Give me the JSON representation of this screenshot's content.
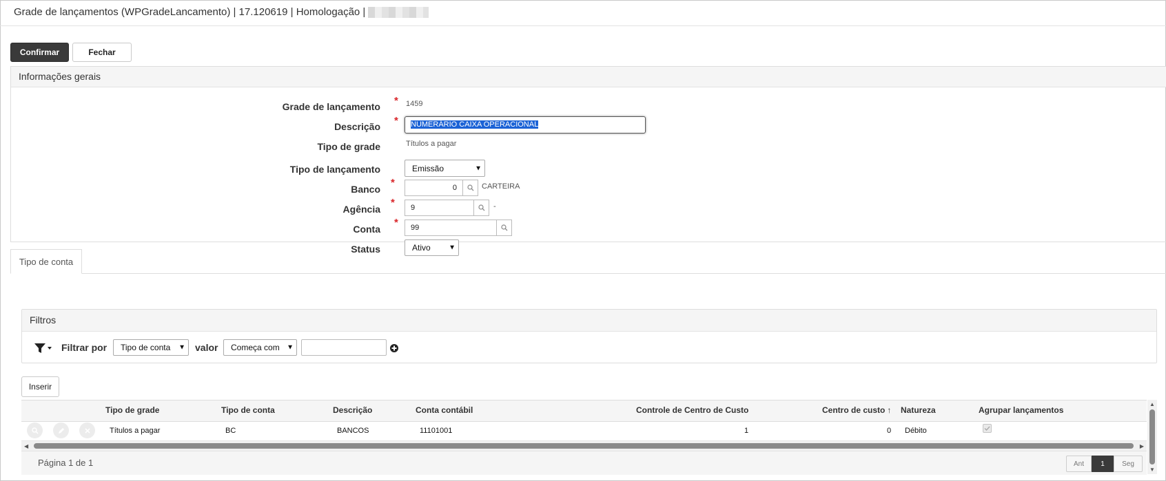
{
  "window": {
    "title": "Grade de lançamentos (WPGradeLancamento) | 17.120619 | Homologação |"
  },
  "toolbar": {
    "confirm_label": "Confirmar",
    "close_label": "Fechar"
  },
  "general_info": {
    "header": "Informações gerais",
    "fields": {
      "grade_label": "Grade de lançamento",
      "grade_value": "1459",
      "descricao_label": "Descrição",
      "descricao_value": "NUMERÁRIO CAIXA OPERACIONAL",
      "tipo_grade_label": "Tipo de grade",
      "tipo_grade_value": "Títulos a pagar",
      "tipo_lancamento_label": "Tipo de lançamento",
      "tipo_lancamento_value": "Emissão",
      "banco_label": "Banco",
      "banco_value": "0",
      "banco_desc": "CARTEIRA",
      "agencia_label": "Agência",
      "agencia_value": "9",
      "agencia_desc": "-",
      "conta_label": "Conta",
      "conta_value": "99",
      "status_label": "Status",
      "status_value": "Ativo"
    },
    "required_mark": "*"
  },
  "tabs": [
    {
      "label": "Tipo de conta",
      "active": true
    }
  ],
  "filters": {
    "header": "Filtros",
    "filter_by_label": "Filtrar por",
    "filter_field_value": "Tipo de conta",
    "value_label": "valor",
    "operator_value": "Começa com",
    "filter_text_value": ""
  },
  "grid": {
    "insert_label": "Inserir",
    "columns": [
      "Tipo de grade",
      "Tipo de conta",
      "Descrição",
      "Conta contábil",
      "Controle de Centro de Custo",
      "Centro de custo",
      "Natureza",
      "Agrupar lançamentos"
    ],
    "sort_indicator": "↑",
    "rows": [
      [
        "Títulos a pagar",
        "BC",
        "BANCOS",
        "11101001",
        "1",
        "0",
        "Débito",
        true
      ]
    ]
  },
  "pagination": {
    "info": "Página 1 de 1",
    "prev_label": "Ant",
    "current_page": "1",
    "next_label": "Seg"
  },
  "colors": {
    "primary_button": "#3a3a3a",
    "required": "#d9262a",
    "selection": "#1c63d6"
  }
}
